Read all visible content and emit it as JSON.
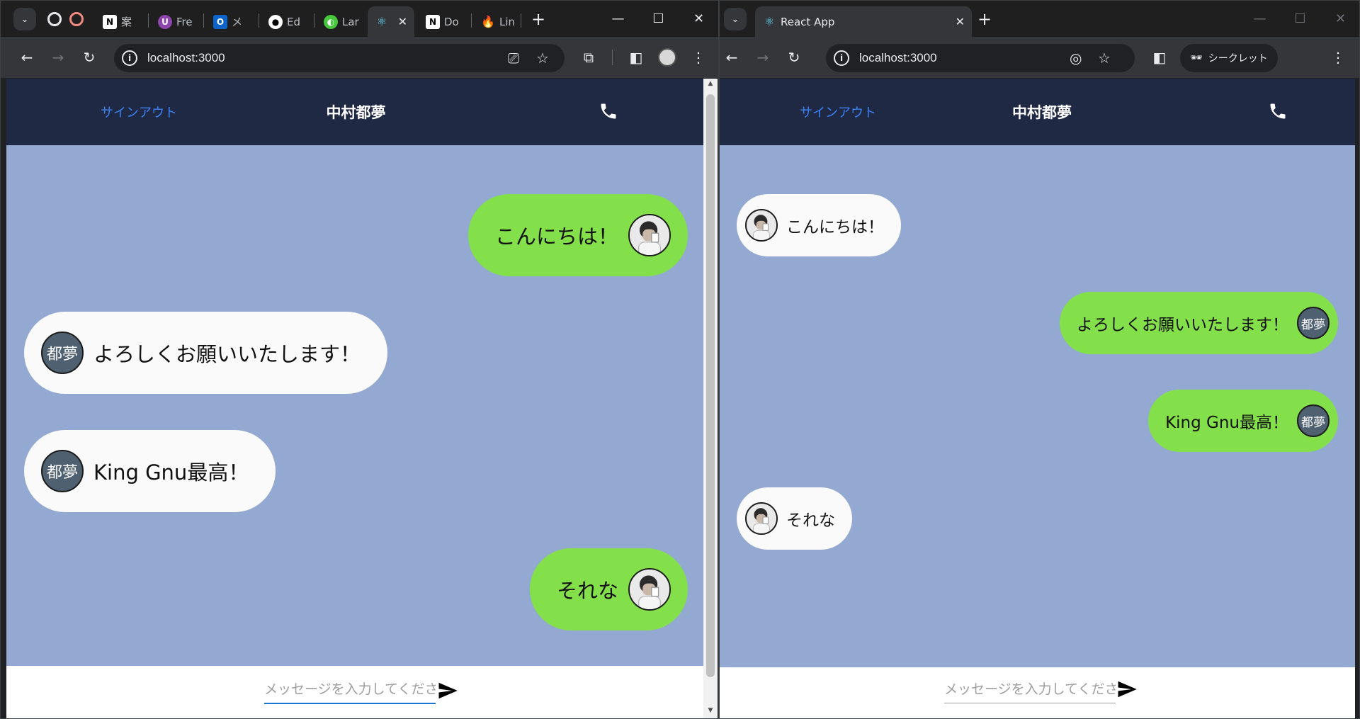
{
  "left_window": {
    "tabs": [
      {
        "label": "案",
        "icon": "notion-icon"
      },
      {
        "label": "Fre",
        "icon": "u-icon"
      },
      {
        "label": "メ",
        "icon": "outlook-icon"
      },
      {
        "label": "Ed",
        "icon": "github-icon"
      },
      {
        "label": "Lar",
        "icon": "green-app-icon"
      },
      {
        "label": "",
        "icon": "react-icon"
      },
      {
        "label": "Do",
        "icon": "notion-icon"
      },
      {
        "label": "Lin",
        "icon": "firebase-icon"
      }
    ],
    "url": "localhost:3000"
  },
  "right_window": {
    "tab_title": "React App",
    "url": "localhost:3000",
    "incognito_label": "シークレット"
  },
  "app": {
    "signout_label": "サインアウト",
    "chat_title": "中村都夢",
    "input_placeholder": "メッセージを入力してください",
    "avatar_text": "都夢"
  },
  "left_messages": [
    {
      "text": "こんにちは！",
      "sender": "me",
      "avatar": "photo"
    },
    {
      "text": "よろしくお願いいたします！",
      "sender": "other",
      "avatar": "text"
    },
    {
      "text": "King Gnu最高！",
      "sender": "other",
      "avatar": "text"
    },
    {
      "text": "それな",
      "sender": "me",
      "avatar": "photo"
    }
  ],
  "right_messages": [
    {
      "text": "こんにちは！",
      "sender": "other",
      "avatar": "photo"
    },
    {
      "text": "よろしくお願いいたします！",
      "sender": "me",
      "avatar": "text"
    },
    {
      "text": "King Gnu最高！",
      "sender": "me",
      "avatar": "text"
    },
    {
      "text": "それな",
      "sender": "other",
      "avatar": "photo"
    }
  ],
  "colors": {
    "chat_background": "#93a9d2",
    "header": "#202944",
    "my_bubble": "#84e04a",
    "other_bubble": "#fafafa",
    "signout_link": "#3b82f6"
  }
}
